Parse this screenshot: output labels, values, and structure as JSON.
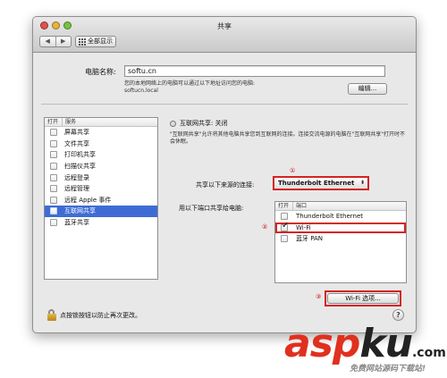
{
  "window": {
    "title": "共享"
  },
  "toolbar": {
    "back_icon": "◀",
    "forward_icon": "▶",
    "show_all_label": "全部显示"
  },
  "computer_name": {
    "label": "电脑名称:",
    "value": "softu.cn",
    "description": "您的本地网络上的电脑可以通过以下地址访问您的电脑:",
    "local_address": "softucn.local",
    "edit_button": "编辑..."
  },
  "services": {
    "header_on": "打开",
    "header_service": "服务",
    "items": [
      {
        "label": "屏幕共享",
        "checked": false,
        "selected": false
      },
      {
        "label": "文件共享",
        "checked": false,
        "selected": false
      },
      {
        "label": "打印机共享",
        "checked": false,
        "selected": false
      },
      {
        "label": "扫描仪共享",
        "checked": false,
        "selected": false
      },
      {
        "label": "远程登录",
        "checked": false,
        "selected": false
      },
      {
        "label": "远程管理",
        "checked": false,
        "selected": false
      },
      {
        "label": "远程 Apple 事件",
        "checked": false,
        "selected": false
      },
      {
        "label": "互联网共享",
        "checked": false,
        "selected": true
      },
      {
        "label": "蓝牙共享",
        "checked": false,
        "selected": false
      }
    ]
  },
  "internet_sharing": {
    "status": "互联网共享: 关闭",
    "description": "\"互联网共享\"允许将其他电脑共享您到互联网的连接。连接交流电源的电脑在\"互联网共享\"打开时不会休眠。",
    "share_from_label": "共享以下来源的连接:",
    "share_from_value": "Thunderbolt Ethernet",
    "share_to_label": "用以下端口共享给电脑:",
    "ports_header_on": "打开",
    "ports_header_port": "端口",
    "ports": [
      {
        "label": "Thunderbolt Ethernet",
        "checked": false
      },
      {
        "label": "Wi-Fi",
        "checked": true
      },
      {
        "label": "蓝牙 PAN",
        "checked": false
      }
    ],
    "wifi_options_button": "Wi-Fi 选项..."
  },
  "annotations": {
    "step1": "①",
    "step2": "②",
    "step3": "③"
  },
  "footer": {
    "lock_text": "点按锁按钮以防止再次更改。",
    "help": "?"
  },
  "watermark": {
    "asp": "asp",
    "ku": "ku",
    "dotcom": ".com",
    "sub": "免费网站源码下载站!"
  },
  "colors": {
    "selection": "#3f6cd4",
    "annotation": "#d62222",
    "watermark_red": "#e0301e"
  }
}
